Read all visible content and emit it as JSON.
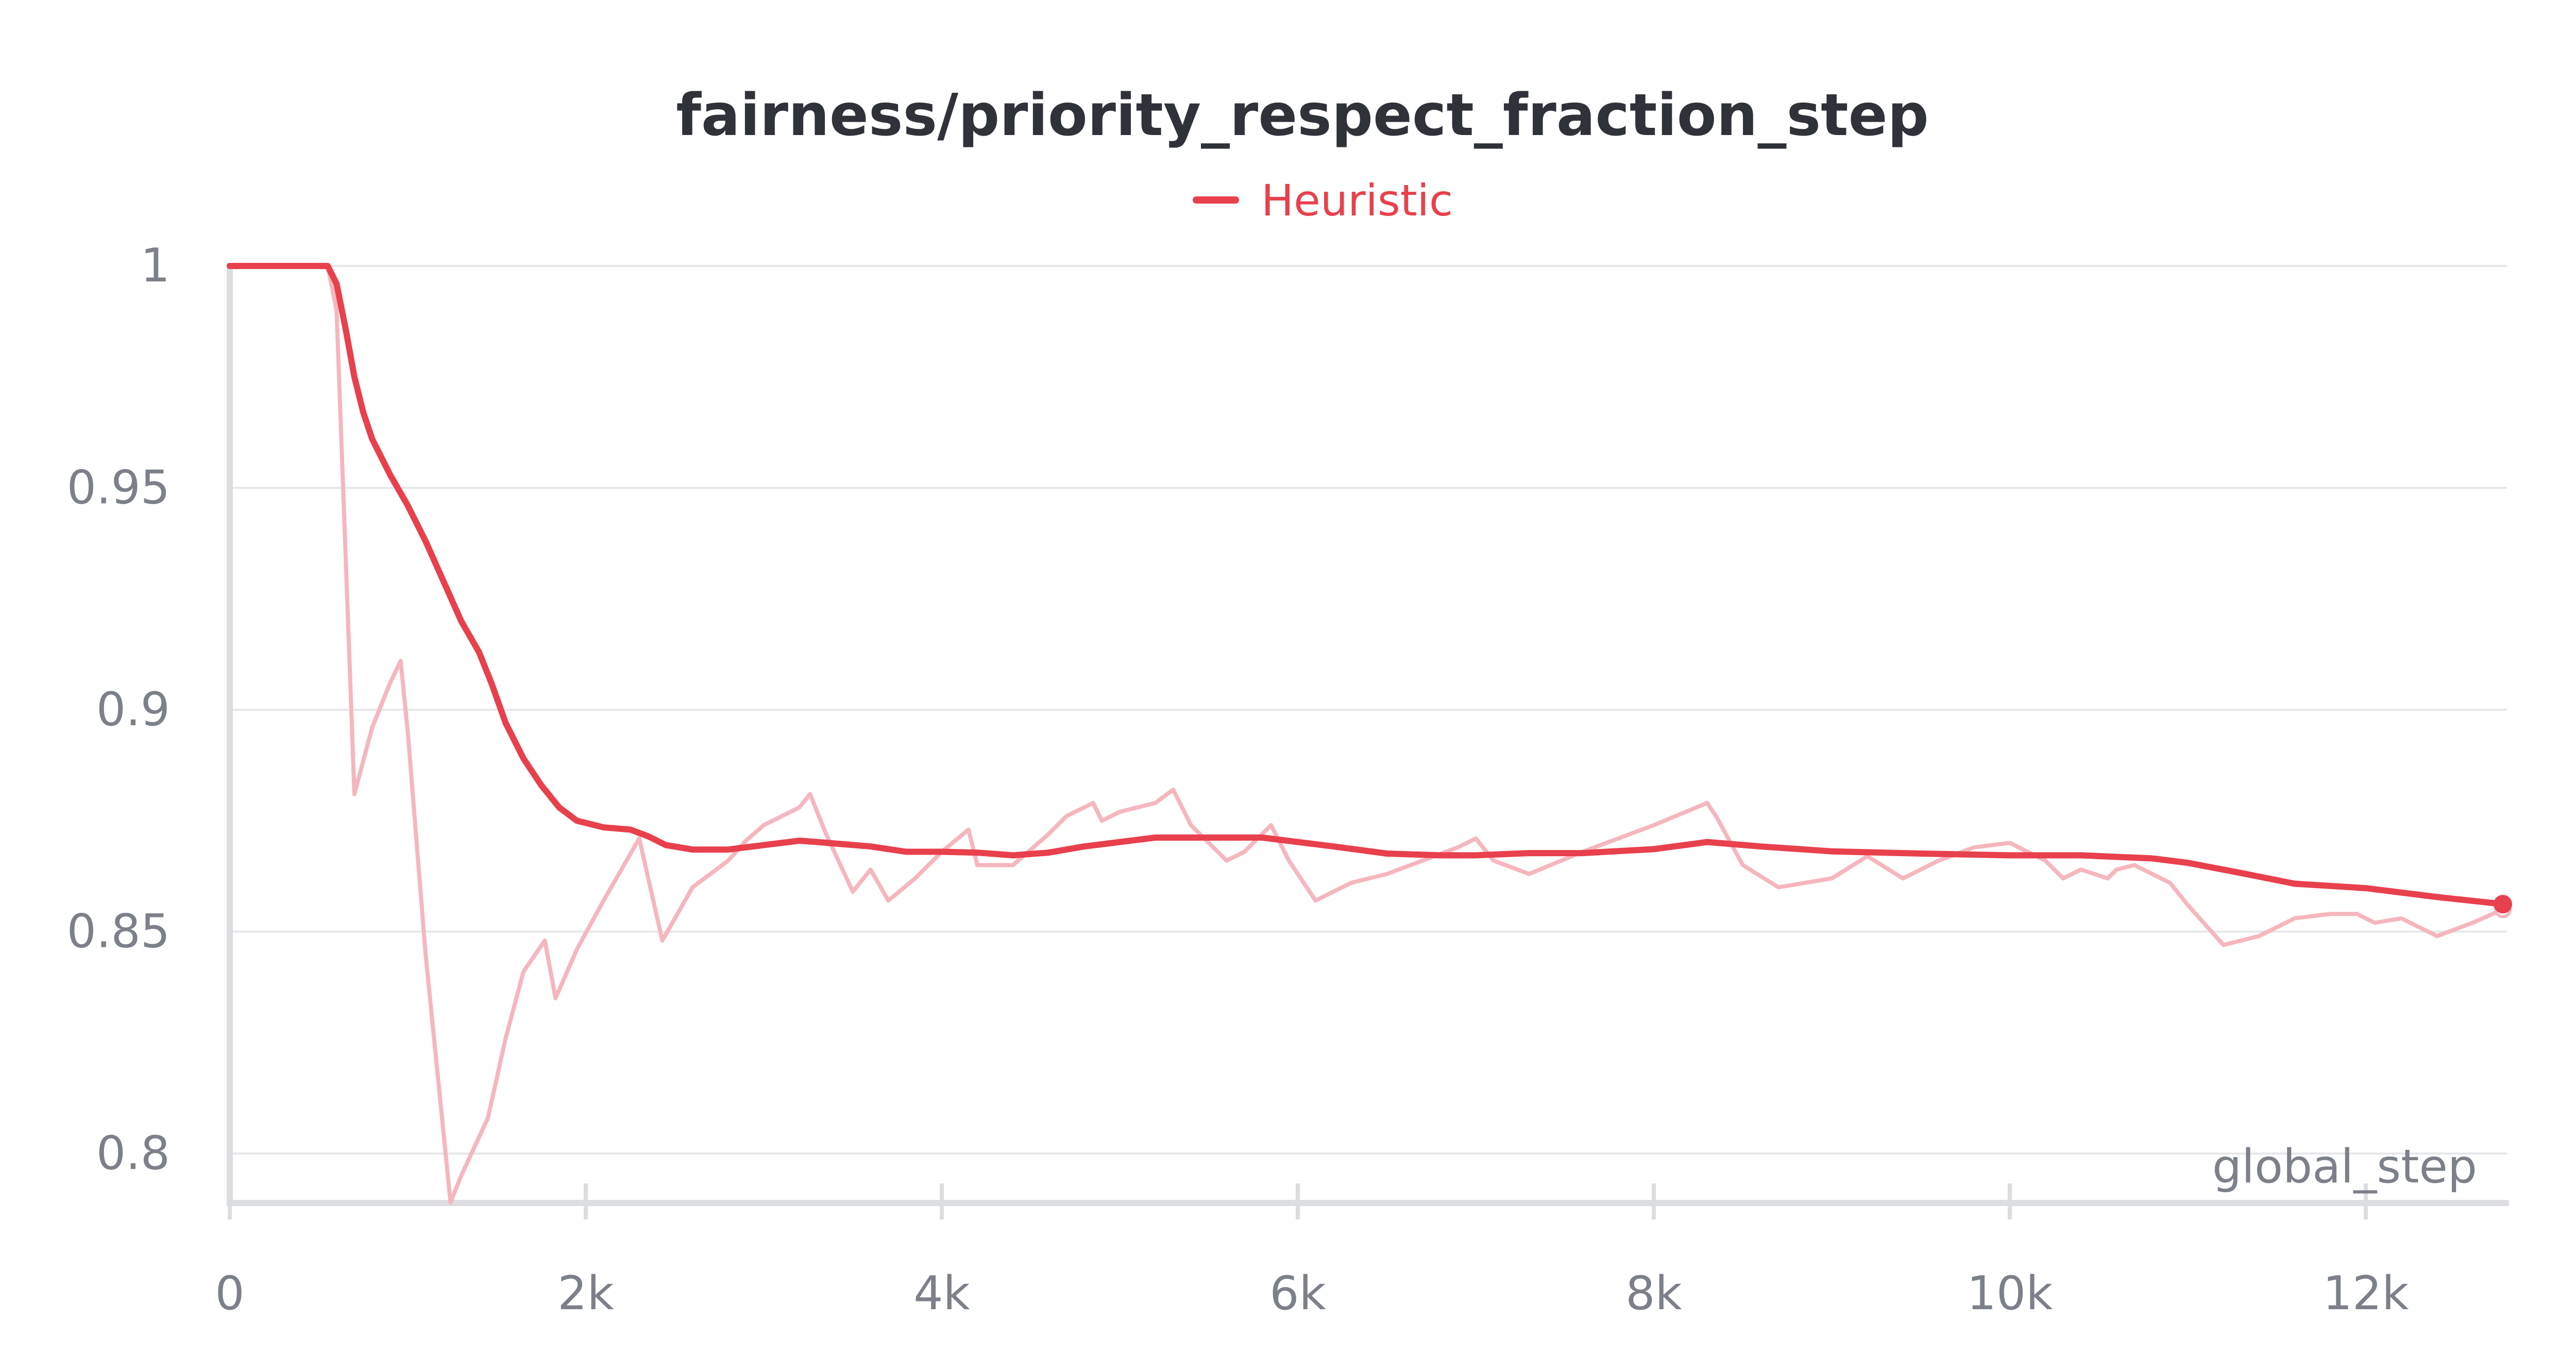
{
  "chart_data": {
    "type": "line",
    "title": "fairness/priority_respect_fraction_step",
    "xlabel": "global_step",
    "ylabel": "",
    "xlim": [
      0,
      12800
    ],
    "ylim": [
      0.789,
      1.0
    ],
    "x_ticks": [
      0,
      2000,
      4000,
      6000,
      8000,
      10000,
      12000
    ],
    "x_tick_labels": [
      "0",
      "2k",
      "4k",
      "6k",
      "8k",
      "10k",
      "12k"
    ],
    "y_ticks": [
      0.8,
      0.85,
      0.9,
      0.95,
      1.0
    ],
    "y_tick_labels": [
      "0.8",
      "0.85",
      "0.9",
      "0.95",
      "1"
    ],
    "grid": true,
    "legend_placement": "top-center",
    "series": [
      {
        "name": "Heuristic",
        "color": "#e8404c",
        "role": "smoothed",
        "x": [
          0,
          300,
          550,
          600,
          650,
          700,
          750,
          800,
          900,
          1000,
          1100,
          1200,
          1300,
          1400,
          1470,
          1550,
          1650,
          1750,
          1850,
          1950,
          2100,
          2250,
          2350,
          2450,
          2600,
          2800,
          3000,
          3200,
          3300,
          3600,
          3800,
          4000,
          4200,
          4400,
          4600,
          4800,
          5000,
          5200,
          5400,
          5600,
          5800,
          6000,
          6200,
          6500,
          6800,
          7000,
          7300,
          7600,
          8000,
          8300,
          8600,
          9000,
          9500,
          10000,
          10400,
          10800,
          11000,
          11300,
          11600,
          12000,
          12400,
          12770
        ],
        "y": [
          1.0,
          1.0,
          1.0,
          0.996,
          0.986,
          0.975,
          0.967,
          0.961,
          0.953,
          0.946,
          0.938,
          0.929,
          0.92,
          0.913,
          0.906,
          0.897,
          0.889,
          0.883,
          0.878,
          0.875,
          0.8735,
          0.873,
          0.8715,
          0.8695,
          0.8685,
          0.8685,
          0.8695,
          0.8705,
          0.8702,
          0.8692,
          0.868,
          0.868,
          0.8678,
          0.8672,
          0.8678,
          0.8692,
          0.8702,
          0.8712,
          0.8712,
          0.8712,
          0.8712,
          0.8702,
          0.8692,
          0.8676,
          0.8672,
          0.8672,
          0.8677,
          0.8677,
          0.8686,
          0.8702,
          0.8692,
          0.8681,
          0.8676,
          0.8672,
          0.8672,
          0.8665,
          0.8655,
          0.8632,
          0.8608,
          0.8598,
          0.8578,
          0.8562
        ]
      },
      {
        "name": "",
        "color": "#f5b6bd",
        "role": "raw",
        "x": [
          0,
          300,
          550,
          600,
          700,
          800,
          900,
          960,
          1000,
          1100,
          1240,
          1300,
          1450,
          1550,
          1650,
          1770,
          1830,
          1950,
          2100,
          2200,
          2300,
          2430,
          2600,
          2800,
          2900,
          3000,
          3200,
          3260,
          3350,
          3500,
          3600,
          3700,
          3850,
          4000,
          4150,
          4200,
          4400,
          4600,
          4700,
          4850,
          4900,
          5000,
          5200,
          5300,
          5400,
          5600,
          5700,
          5850,
          5950,
          6100,
          6300,
          6500,
          6900,
          7000,
          7100,
          7300,
          7600,
          8000,
          8300,
          8350,
          8500,
          8700,
          9000,
          9200,
          9400,
          9600,
          9800,
          10000,
          10200,
          10300,
          10400,
          10550,
          10600,
          10700,
          10850,
          10900,
          11000,
          11200,
          11400,
          11600,
          11800,
          11950,
          12000,
          12050,
          12200,
          12400,
          12600,
          12770
        ],
        "y": [
          1.0,
          1.0,
          1.0,
          0.99,
          0.881,
          0.896,
          0.906,
          0.911,
          0.895,
          0.845,
          0.789,
          0.795,
          0.808,
          0.826,
          0.841,
          0.848,
          0.835,
          0.846,
          0.857,
          0.864,
          0.871,
          0.848,
          0.86,
          0.866,
          0.8705,
          0.874,
          0.878,
          0.881,
          0.872,
          0.859,
          0.864,
          0.857,
          0.862,
          0.868,
          0.873,
          0.865,
          0.865,
          0.872,
          0.876,
          0.879,
          0.875,
          0.877,
          0.879,
          0.882,
          0.874,
          0.866,
          0.868,
          0.874,
          0.866,
          0.857,
          0.861,
          0.863,
          0.869,
          0.871,
          0.866,
          0.863,
          0.868,
          0.874,
          0.879,
          0.876,
          0.865,
          0.86,
          0.862,
          0.867,
          0.862,
          0.866,
          0.869,
          0.87,
          0.866,
          0.862,
          0.864,
          0.862,
          0.864,
          0.865,
          0.862,
          0.861,
          0.856,
          0.847,
          0.849,
          0.853,
          0.854,
          0.854,
          0.853,
          0.852,
          0.853,
          0.849,
          0.852,
          0.855
        ]
      }
    ]
  }
}
